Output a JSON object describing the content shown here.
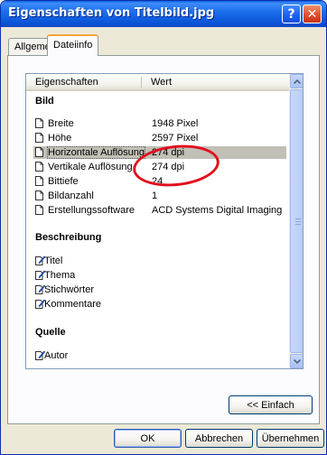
{
  "window": {
    "title": "Eigenschaften von Titelbild.jpg",
    "help_label": "?",
    "close_label": "✕"
  },
  "tabs": [
    {
      "label": "Allgemein",
      "active": false
    },
    {
      "label": "Dateiinfo",
      "active": true
    }
  ],
  "list": {
    "columns": {
      "property": "Eigenschaften",
      "value": "Wert"
    },
    "groups": [
      {
        "title": "Bild",
        "rows": [
          {
            "label": "Breite",
            "value": "1948 Pixel"
          },
          {
            "label": "Höhe",
            "value": "2597 Pixel"
          },
          {
            "label": "Horizontale Auflösung",
            "value": "274 dpi",
            "selected": true
          },
          {
            "label": "Vertikale Auflösung",
            "value": "274 dpi"
          },
          {
            "label": "Bittiefe",
            "value": "24"
          },
          {
            "label": "Bildanzahl",
            "value": "1"
          },
          {
            "label": "Erstellungssoftware",
            "value": "ACD Systems Digital Imaging"
          }
        ]
      },
      {
        "title": "Beschreibung",
        "rows": [
          {
            "label": "Titel",
            "value": ""
          },
          {
            "label": "Thema",
            "value": ""
          },
          {
            "label": "Stichwörter",
            "value": ""
          },
          {
            "label": "Kommentare",
            "value": ""
          }
        ]
      },
      {
        "title": "Quelle",
        "rows": [
          {
            "label": "Autor",
            "value": ""
          }
        ]
      }
    ]
  },
  "buttons": {
    "einfach": "<< Einfach",
    "ok": "OK",
    "abbrechen": "Abbrechen",
    "uebernehmen": "Übernehmen"
  },
  "colors": {
    "titlebar": "#0a53d6",
    "highlight_circle": "#e0101e",
    "selection": "#c2c0b6"
  }
}
